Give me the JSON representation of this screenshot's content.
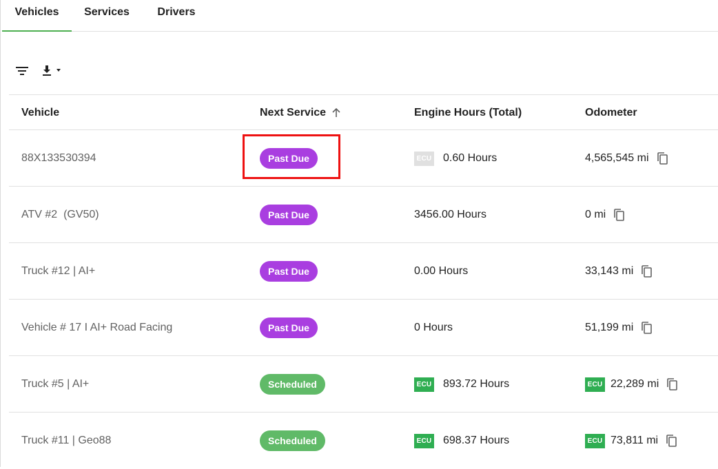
{
  "tabs": [
    {
      "label": "Vehicles",
      "active": true
    },
    {
      "label": "Services",
      "active": false
    },
    {
      "label": "Drivers",
      "active": false
    }
  ],
  "toolbar": {
    "filter_icon": "filter-icon",
    "download_icon": "download-icon"
  },
  "table": {
    "headers": {
      "vehicle": "Vehicle",
      "next_service": "Next Service",
      "engine_hours": "Engine Hours (Total)",
      "odometer": "Odometer"
    },
    "rows": [
      {
        "vehicle": "88X133530394",
        "status": "Past Due",
        "hours_ecu": "ECU",
        "hours": "0.60 Hours",
        "odo_ecu": "",
        "odometer": "4,565,545 mi"
      },
      {
        "vehicle": "ATV #2  (GV50)",
        "status": "Past Due",
        "hours_ecu": "",
        "hours": "3456.00 Hours",
        "odo_ecu": "",
        "odometer": "0 mi"
      },
      {
        "vehicle": "Truck #12 | AI+",
        "status": "Past Due",
        "hours_ecu": "",
        "hours": "0.00 Hours",
        "odo_ecu": "",
        "odometer": "33,143 mi"
      },
      {
        "vehicle": "Vehicle # 17 I AI+ Road Facing",
        "status": "Past Due",
        "hours_ecu": "",
        "hours": "0 Hours",
        "odo_ecu": "",
        "odometer": "51,199 mi"
      },
      {
        "vehicle": "Truck #5 | AI+",
        "status": "Scheduled",
        "hours_ecu": "ECU",
        "hours": "893.72 Hours",
        "odo_ecu": "ECU",
        "odometer": "22,289 mi"
      },
      {
        "vehicle": "Truck #11 | Geo88",
        "status": "Scheduled",
        "hours_ecu": "ECU",
        "hours": "698.37 Hours",
        "odo_ecu": "ECU",
        "odometer": "73,811 mi"
      }
    ]
  },
  "colors": {
    "past_due": "#a93ee0",
    "scheduled": "#60ba68",
    "ecu_active": "#2fae52",
    "ecu_inactive": "#e0e0e0",
    "tab_indicator": "#4caf50",
    "highlight": "#ee1111"
  }
}
